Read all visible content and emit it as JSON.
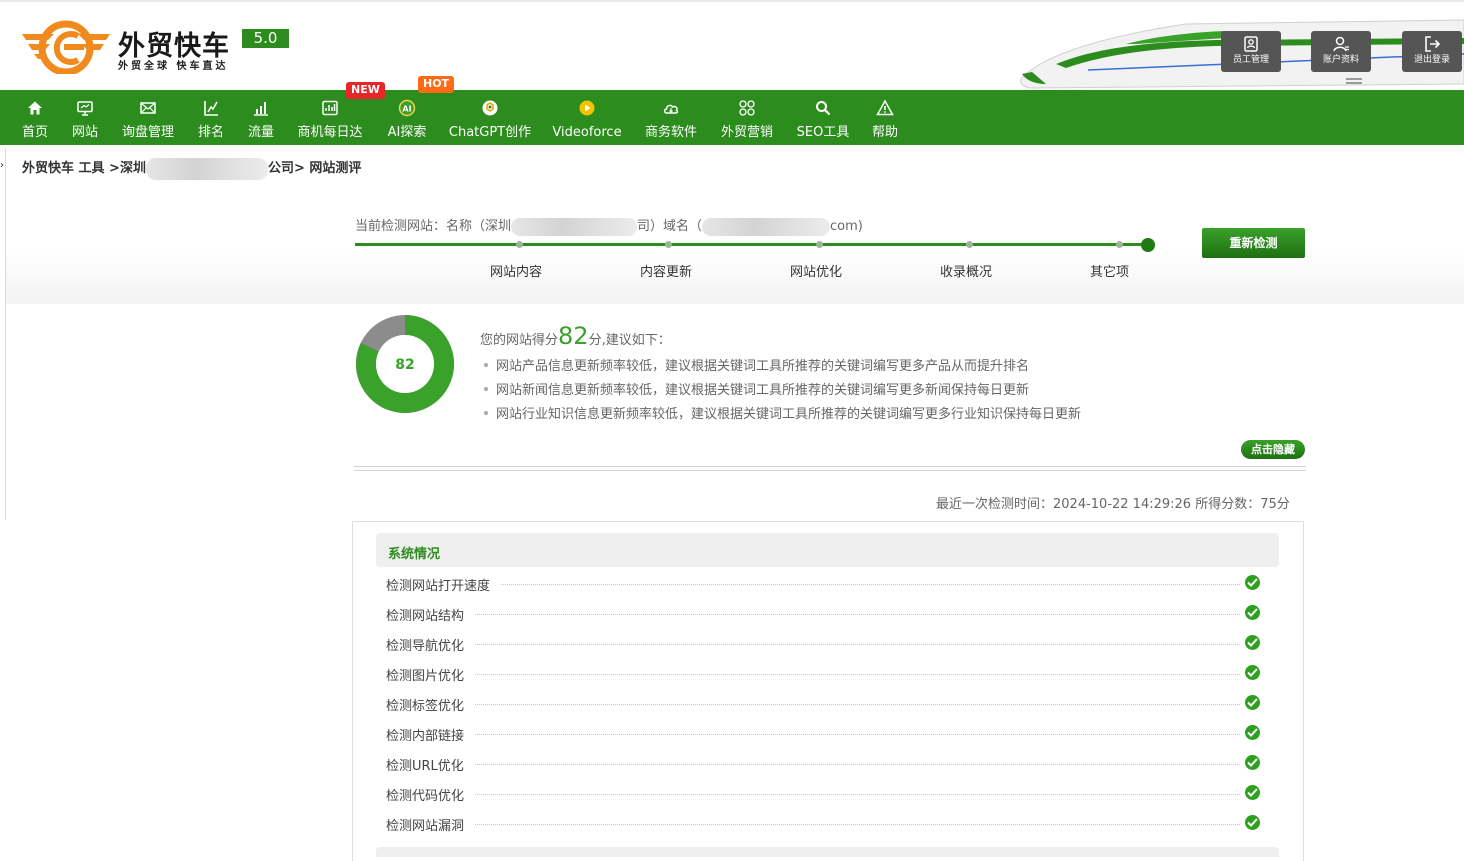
{
  "brand": {
    "title": "外贸快车",
    "version": "5.0",
    "subtitle": "外贸全球 快车直达"
  },
  "header_buttons": [
    {
      "label": "员工管理",
      "icon": "staff-icon"
    },
    {
      "label": "账户资料",
      "icon": "user-icon"
    },
    {
      "label": "退出登录",
      "icon": "logout-icon"
    }
  ],
  "nav": {
    "items": [
      {
        "label": "首页",
        "icon": "home-icon"
      },
      {
        "label": "网站",
        "icon": "monitor-icon"
      },
      {
        "label": "询盘管理",
        "icon": "mail-icon"
      },
      {
        "label": "排名",
        "icon": "ranking-icon"
      },
      {
        "label": "流量",
        "icon": "bar-chart-icon"
      },
      {
        "label": "商机每日达",
        "icon": "chart-box-icon"
      },
      {
        "label": "AI探索",
        "icon": "ai-icon"
      },
      {
        "label": "ChatGPT创作",
        "icon": "chatgpt-icon"
      },
      {
        "label": "Videoforce",
        "icon": "video-icon"
      },
      {
        "label": "商务软件",
        "icon": "cloud-icon"
      },
      {
        "label": "外贸营销",
        "icon": "grid-icon"
      },
      {
        "label": "SEO工具",
        "icon": "search-icon"
      },
      {
        "label": "帮助",
        "icon": "warning-icon"
      }
    ],
    "badge_new": "NEW",
    "badge_hot": "HOT"
  },
  "breadcrumb": {
    "part1": "外贸快车 工具 >",
    "part2": "深圳",
    "part3": "公司>",
    "current": "网站测评"
  },
  "progress": {
    "current_site_prefix": "当前检测网站：名称（深圳",
    "current_site_mid": "司）域名（",
    "current_site_suffix": "com)",
    "steps": [
      "网站内容",
      "内容更新",
      "网站优化",
      "收录概况",
      "其它项"
    ],
    "recheck_label": "重新检测"
  },
  "score": {
    "value": 82,
    "value_text": "82",
    "head_prefix": "您的网站得分",
    "head_suffix": "分,建议如下：",
    "advice": [
      "网站产品信息更新频率较低，建议根据关键词工具所推荐的关键词编写更多产品从而提升排名",
      "网站新闻信息更新频率较低，建议根据关键词工具所推荐的关键词编写更多新闻保持每日更新",
      "网站行业知识信息更新频率较低，建议根据关键词工具所推荐的关键词编写更多行业知识保持每日更新"
    ],
    "hide_label": "点击隐藏",
    "last_check": "最近一次检测时间：2024-10-22 14:29:26 所得分数：75分"
  },
  "system": {
    "title": "系统情况",
    "checks": [
      "检测网站打开速度",
      "检测网站结构",
      "检测导航优化",
      "检测图片优化",
      "检测标签优化",
      "检测内部链接",
      "检测URL优化",
      "检测代码优化",
      "检测网站漏洞"
    ]
  },
  "colors": {
    "brand_green": "#2d8c1e",
    "accent_green": "#3aa12a",
    "donut_rest": "#8c8c8c",
    "logo_orange": "#f08a1c"
  }
}
